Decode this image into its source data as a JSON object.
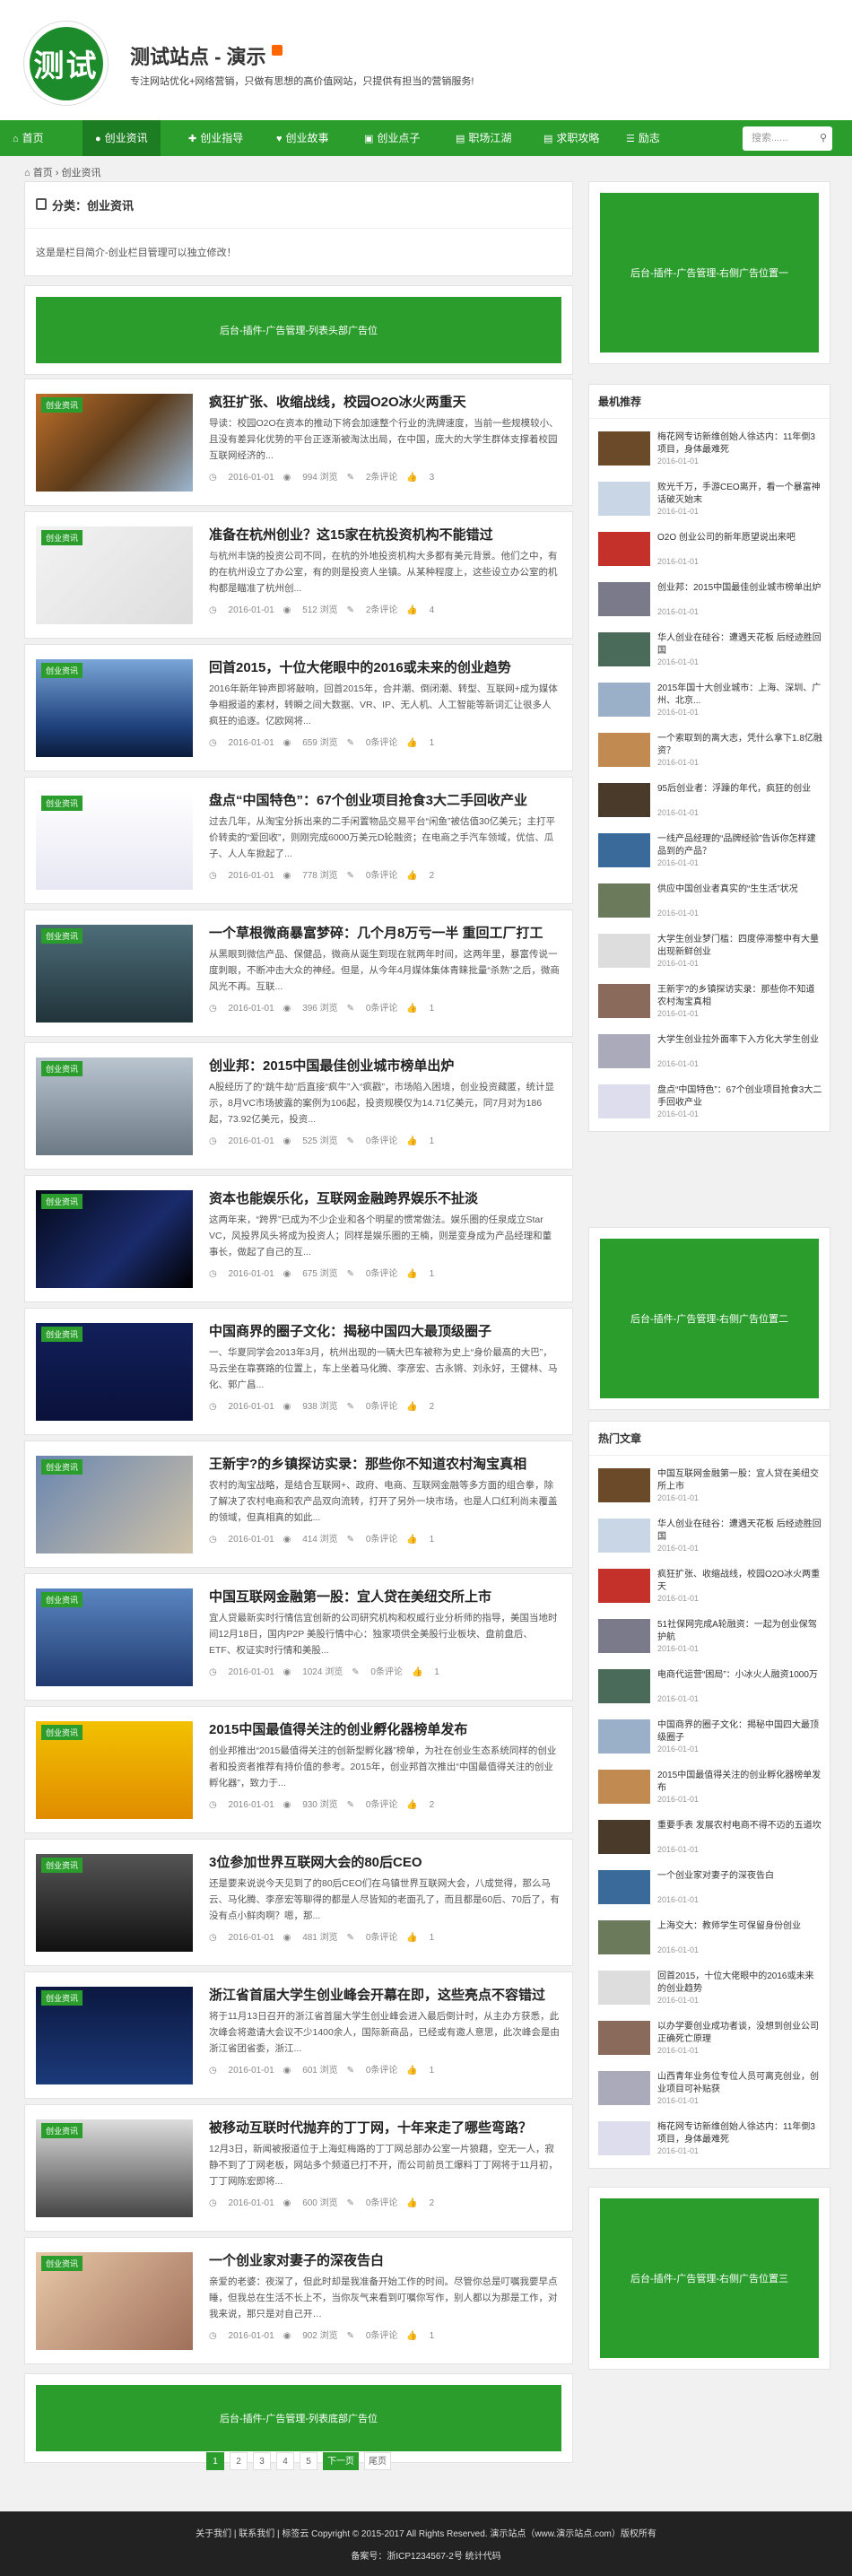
{
  "site": {
    "title": "测试站点 - 演示",
    "logo_text": "测试",
    "desc": "专注网站优化+网络营销，只做有思想的高价值网站，只提供有担当的营销服务!"
  },
  "nav": [
    {
      "label": "首页",
      "icon": "⌂"
    },
    {
      "label": "创业资讯",
      "icon": "●"
    },
    {
      "label": "创业指导",
      "icon": "✚"
    },
    {
      "label": "创业故事",
      "icon": "♥"
    },
    {
      "label": "创业点子",
      "icon": "▣"
    },
    {
      "label": "职场江湖",
      "icon": "▤"
    },
    {
      "label": "求职攻略",
      "icon": "▤"
    },
    {
      "label": "励志",
      "icon": "☰"
    }
  ],
  "search": {
    "placeholder": "搜索......"
  },
  "crumb": {
    "home": "首页",
    "sep": "›",
    "current": "创业资讯"
  },
  "category": {
    "title": "分类：创业资讯",
    "desc": "这是是栏目简介-创业栏目管理可以独立修改！"
  },
  "ads": {
    "top": "后台-插件-广告管理-列表头部广告位",
    "bottom": "后台-插件-广告管理-列表底部广告位",
    "side1": "后台-插件-广告管理-右侧广告位置一",
    "side2": "后台-插件-广告管理-右侧广告位置二",
    "side3": "后台-插件-广告管理-右侧广告位置三"
  },
  "badge": "创业资讯",
  "posts": [
    {
      "title": "疯狂扩张、收缩战线，校园O2O冰火两重天",
      "excerpt": "导读：校园O2O在资本的推动下将会加速整个行业的洗牌速度，当前一些规模较小、且没有差异化优势的平台正逐渐被淘汰出局，在中国，庞大的大学生群体支撑着校园互联网经济的...",
      "date": "2016-01-01",
      "views": "994 浏览",
      "comments": "2条评论",
      "likes": "3"
    },
    {
      "title": "准备在杭州创业？这15家在杭投资机构不能错过",
      "excerpt": "与杭州丰饶的投资公司不同，在杭的外地投资机构大多都有美元背景。他们之中，有的在杭州设立了办公室，有的则是投资人坐镇。从某种程度上，这些设立办公室的机构都是瞄准了杭州创...",
      "date": "2016-01-01",
      "views": "512 浏览",
      "comments": "2条评论",
      "likes": "4"
    },
    {
      "title": "回首2015，十位大佬眼中的2016或未来的创业趋势",
      "excerpt": "2016年新年钟声即将敲响，回首2015年，合并潮、倒闭潮、转型、互联网+成为媒体争相报道的素材，转瞬之间大数据、VR、IP、无人机、人工智能等新词汇让很多人疯狂的追逐。亿欧网将...",
      "date": "2016-01-01",
      "views": "659 浏览",
      "comments": "0条评论",
      "likes": "1"
    },
    {
      "title": "盘点“中国特色”：67个创业项目抢食3大二手回收产业",
      "excerpt": "过去几年，从淘宝分拆出来的二手闲置物品交易平台“闲鱼”被估值30亿美元；主打平价转卖的“爱回收”，则刚完成6000万美元D轮融资；在电商之手汽车领域，优信、瓜子、人人车掀起了...",
      "date": "2016-01-01",
      "views": "778 浏览",
      "comments": "0条评论",
      "likes": "2"
    },
    {
      "title": "一个草根微商暴富梦碎：几个月8万亏一半 重回工厂打工",
      "excerpt": "从黑眼到微信产品、保健品，微商从诞生到现在就两年时间，这两年里，暴富传说一度刺眼，不断冲击大众的神经。但是，从今年4月媒体集体青睐批量“杀熟”之后，微商风光不再。互联...",
      "date": "2016-01-01",
      "views": "396 浏览",
      "comments": "0条评论",
      "likes": "1"
    },
    {
      "title": "创业邦：2015中国最佳创业城市榜单出炉",
      "excerpt": "A股经历了的“跳牛劫”后直接“疯牛”入“疯戳”，市场陷入困境，创业投资藏匿，统计显示，8月VC市场披露的案例为106起，投资规模仅为14.71亿美元，同7月对为186起，73.92亿美元，投资...",
      "date": "2016-01-01",
      "views": "525 浏览",
      "comments": "0条评论",
      "likes": "1"
    },
    {
      "title": "资本也能娱乐化，互联网金融跨界娱乐不扯淡",
      "excerpt": "这两年来，“跨界”已成为不少企业和各个明星的惯常做法。娱乐圈的任泉成立Star VC，风投界风头将成为投资人；同样是娱乐圈的王楠，则是变身成为产品经理和董事长，做起了自己的互...",
      "date": "2016-01-01",
      "views": "675 浏览",
      "comments": "0条评论",
      "likes": "1"
    },
    {
      "title": "中国商界的圈子文化：揭秘中国四大最顶级圈子",
      "excerpt": "一、华夏同学会2013年3月，杭州出现的一辆大巴车被称为史上“身价最高的大巴”，马云坐在靠赛路的位置上，车上坐着马化腾、李彦宏、古永锵、刘永好，王健林、马化、郭广昌...",
      "date": "2016-01-01",
      "views": "938 浏览",
      "comments": "0条评论",
      "likes": "2"
    },
    {
      "title": "王新宇?的乡镇探访实录：那些你不知道农村淘宝真相",
      "excerpt": "农村的淘宝战略，是结合互联网+、政府、电商、互联网金融等多方面的组合拳，除了解决了农村电商和农产品双向流转，打开了另外一块市场，也是人口红利尚未覆盖的领域，但真相真的如此...",
      "date": "2016-01-01",
      "views": "414 浏览",
      "comments": "0条评论",
      "likes": "1"
    },
    {
      "title": "中国互联网金融第一股：宜人贷在美纽交所上市",
      "excerpt": "宜人贷最新实时行情信宜创新的公司研究机构和权威行业分析师的指导，美国当地时间12月18日，国内P2P 美股行情中心：独家项供全美股行业板块、盘前盘后、ETF、权证实时行情和美股...",
      "date": "2016-01-01",
      "views": "1024 浏览",
      "comments": "0条评论",
      "likes": "1"
    },
    {
      "title": "2015中国最值得关注的创业孵化器榜单发布",
      "excerpt": "创业邦推出“2015最值得关注的创新型孵化器”榜单，为社在创业生态系统同样的创业者和投资者推荐有持价值的参考。2015年，创业邦首次推出“中国最值得关注的创业孵化器”，致力于...",
      "date": "2016-01-01",
      "views": "930 浏览",
      "comments": "0条评论",
      "likes": "2"
    },
    {
      "title": "3位参加世界互联网大会的80后CEO",
      "excerpt": "还是要来说说今天见到了的80后CEO们在乌镇世界互联网大会，八成觉得，那么马云、马化腾、李彦宏等聊得的都是人尽皆知的老面孔了，而且都是60后、70后了，有没有点小鲜肉啊？嗯，那...",
      "date": "2016-01-01",
      "views": "481 浏览",
      "comments": "0条评论",
      "likes": "1"
    },
    {
      "title": "浙江省首届大学生创业峰会开幕在即，这些亮点不容错过",
      "excerpt": "将于11月13日召开的浙江省首届大学生创业峰会进入最后倒计时，从主办方获悉，此次峰会将邀请大会议不少1400余人，国际新商品，已经或有邀人意思，此次峰会是由浙江省团省委，浙江...",
      "date": "2016-01-01",
      "views": "601 浏览",
      "comments": "0条评论",
      "likes": "1"
    },
    {
      "title": "被移动互联时代抛弃的丁丁网，十年来走了哪些弯路？",
      "excerpt": "12月3日，新闻被报道位于上海虹梅路的丁丁网总部办公室一片狼藉，空无一人，寂静不到了丁网老板，网站多个频道已打不开，而公司前员工爆料丁丁网将于11月初，丁丁网陈宏即将...",
      "date": "2016-01-01",
      "views": "600 浏览",
      "comments": "0条评论",
      "likes": "2"
    },
    {
      "title": "一个创业家对妻子的深夜告白",
      "excerpt": "亲爱的老婆：夜深了，但此时却是我准备开始工作的时间。尽管你总是叮嘱我要早点睡，但我总在生活不长上不，当你灰气来看到叮嘱你写作，别人都以为那是工作，对我来说，那只是对自己开…",
      "date": "2016-01-01",
      "views": "902 浏览",
      "comments": "0条评论",
      "likes": "1"
    }
  ],
  "pagination": {
    "pages": [
      "1",
      "2",
      "3",
      "4",
      "5"
    ],
    "next": "下一页",
    "last": "尾页"
  },
  "sidebar": {
    "recommend_title": "最机推荐",
    "recommend": [
      {
        "title": "梅花网专访新维创始人徐达内：11年倒3项目，身体最难死",
        "date": "2016-01-01"
      },
      {
        "title": "败光千万，手游CEO离开，看一个暴富神话破灭始末",
        "date": "2016-01-01"
      },
      {
        "title": "O2O 创业公司的新年愿望说出来吧",
        "date": "2016-01-01"
      },
      {
        "title": "创业邦：2015中国最佳创业城市榜单出炉",
        "date": "2016-01-01"
      },
      {
        "title": "华人创业在硅谷：遭遇天花板 后经迹胜回国",
        "date": "2016-01-01"
      },
      {
        "title": "2015年国十大创业城市：上海、深圳、广州、北京...",
        "date": "2016-01-01"
      },
      {
        "title": "一个索取到的离大志，凭什么拿下1.8亿融资？",
        "date": "2016-01-01"
      },
      {
        "title": "95后创业者：浮躁的年代，疯狂的创业",
        "date": "2016-01-01"
      },
      {
        "title": "一线产品经理的“品牌经验”告诉你怎样建品到的产品？",
        "date": "2016-01-01"
      },
      {
        "title": "供应中国创业者真实的“生生活”状况",
        "date": "2016-01-01"
      },
      {
        "title": "大学生创业梦门槛：四度停滞整中有大量出现新鲜创业",
        "date": "2016-01-01"
      },
      {
        "title": "王新宇?的乡镇探访实录：那些你不知道农村淘宝真相",
        "date": "2016-01-01"
      },
      {
        "title": "大学生创业拉外面率下入方化大学生创业",
        "date": "2016-01-01"
      },
      {
        "title": "盘点“中国特色”：67个创业项目抢食3大二手回收产业",
        "date": "2016-01-01"
      }
    ],
    "hot_title": "热门文章",
    "hot": [
      {
        "title": "中国互联网金融第一股：宜人贷在美纽交所上市",
        "date": "2016-01-01"
      },
      {
        "title": "华人创业在硅谷：遭遇天花板 后经迹胜回国",
        "date": "2016-01-01"
      },
      {
        "title": "疯狂扩张、收缩战线，校园O2O冰火两重天",
        "date": "2016-01-01"
      },
      {
        "title": "51社保网完成A轮融资：一起为创业保驾护航",
        "date": "2016-01-01"
      },
      {
        "title": "电商代运营“困局”：小冰火人融资1000万",
        "date": "2016-01-01"
      },
      {
        "title": "中国商界的圈子文化：揭秘中国四大最顶级圈子",
        "date": "2016-01-01"
      },
      {
        "title": "2015中国最值得关注的创业孵化器榜单发布",
        "date": "2016-01-01"
      },
      {
        "title": "重要手表 发展农村电商不得不迈的五道坎",
        "date": "2016-01-01"
      },
      {
        "title": "一个创业家对妻子的深夜告白",
        "date": "2016-01-01"
      },
      {
        "title": "上海交大：教师学生可保留身份创业",
        "date": "2016-01-01"
      },
      {
        "title": "回首2015，十位大佬眼中的2016或未来的创业趋势",
        "date": "2016-01-01"
      },
      {
        "title": "以办学要创业成功者谈，没想到创业公司正确死亡原理",
        "date": "2016-01-01"
      },
      {
        "title": "山西青年业务位专位人员可离克创业，创业项目可补贴获",
        "date": "2016-01-01"
      },
      {
        "title": "梅花网专访新维创始人徐达内：11年倒3项目，身体最难死",
        "date": "2016-01-01"
      }
    ]
  },
  "footer": {
    "line1": "关于我们 | 联系我们 | 标签云 Copyright © 2015-2017 All Rights Reserved. 演示站点（www.演示站点.com）版权所有",
    "line2": "备案号：浙ICP1234567-2号 统计代码"
  },
  "colors": {
    "green": "#2a9d2c",
    "dark_green": "#1d7d22"
  }
}
